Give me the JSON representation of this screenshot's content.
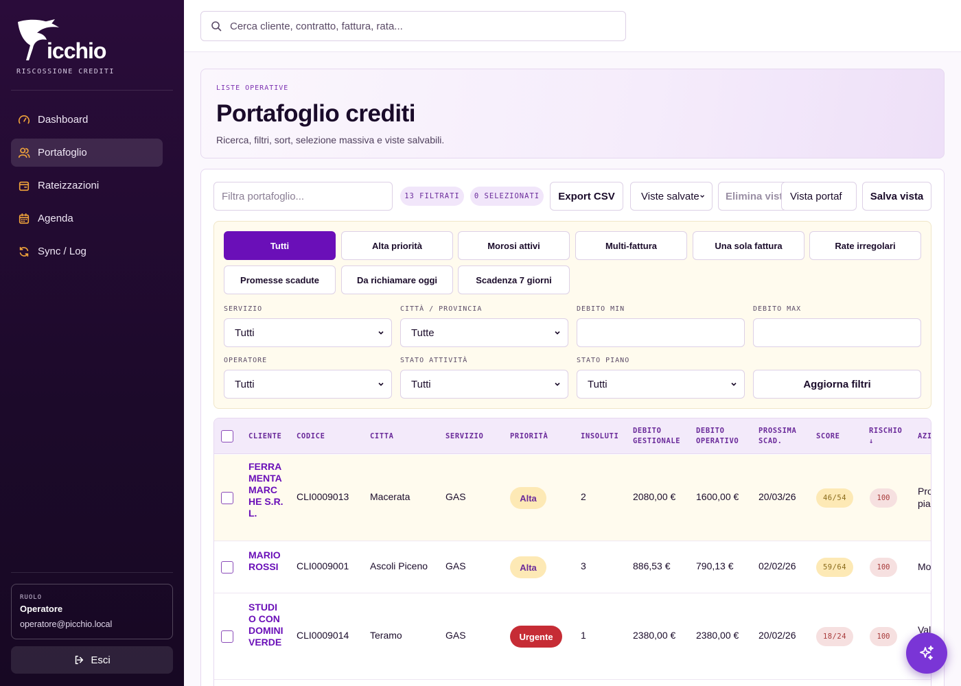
{
  "brand": {
    "name": "icchio",
    "subtitle": "RISCOSSIONE CREDITI"
  },
  "sidebar": {
    "items": [
      {
        "label": "Dashboard",
        "icon": "gauge-icon"
      },
      {
        "label": "Portafoglio",
        "icon": "users-icon",
        "active": true
      },
      {
        "label": "Rateizzazioni",
        "icon": "wallet-icon"
      },
      {
        "label": "Agenda",
        "icon": "calendar-icon"
      },
      {
        "label": "Sync / Log",
        "icon": "sync-icon"
      }
    ],
    "role_label": "RUOLO",
    "role_name": "Operatore",
    "role_email": "operatore@picchio.local",
    "logout_label": "Esci"
  },
  "search": {
    "placeholder": "Cerca cliente, contratto, fattura, rata..."
  },
  "hero": {
    "kicker": "LISTE OPERATIVE",
    "title": "Portafoglio crediti",
    "subtitle": "Ricerca, filtri, sort, selezione massiva e viste salvabili."
  },
  "toolbar": {
    "filter_placeholder": "Filtra portafoglio...",
    "filtered_pill": "13 FILTRATI",
    "selected_pill": "0 SELEZIONATI",
    "export_label": "Export CSV",
    "saved_views_label": "Viste salvate",
    "delete_view_label": "Elimina vista",
    "view_name_value": "Vista portaf",
    "save_view_label": "Salva vista"
  },
  "quick_filters": [
    "Tutti",
    "Alta priorità",
    "Morosi attivi",
    "Multi-fattura",
    "Una sola fattura",
    "Rate irregolari",
    "Promesse scadute",
    "Da richiamare oggi",
    "Scadenza 7 giorni"
  ],
  "filters": {
    "servizio": {
      "label": "SERVIZIO",
      "value": "Tutti"
    },
    "citta": {
      "label": "CITTÀ / PROVINCIA",
      "value": "Tutte"
    },
    "debito_min": {
      "label": "DEBITO MIN",
      "value": ""
    },
    "debito_max": {
      "label": "DEBITO MAX",
      "value": ""
    },
    "operatore": {
      "label": "OPERATORE",
      "value": "Tutti"
    },
    "stato_attivita": {
      "label": "STATO ATTIVITÀ",
      "value": "Tutti"
    },
    "stato_piano": {
      "label": "STATO PIANO",
      "value": "Tutti"
    },
    "update_label": "Aggiorna filtri"
  },
  "table": {
    "headers": {
      "cliente": "CLIENTE",
      "codice": "CODICE",
      "citta": "CITTA",
      "servizio": "SERVIZIO",
      "priorita": "PRIORITÀ",
      "insoluti": "INSOLUTI",
      "debito_gestionale": "DEBITO GESTIONALE",
      "debito_operativo": "DEBITO OPERATIVO",
      "prossima_scad": "PROSSIMA SCAD.",
      "score": "SCORE",
      "rischio": "RISCHIO ↓",
      "azioni": "AZI"
    },
    "rows": [
      {
        "cliente": "FERRAMENTA MARCHE S.R.L.",
        "codice": "CLI0009013",
        "citta": "Macerata",
        "servizio": "GAS",
        "priorita": "Alta",
        "insoluti": "2",
        "debito_gestionale": "2080,00 €",
        "debito_operativo": "1600,00 €",
        "prossima_scad": "20/03/26",
        "score": "46/54",
        "rischio": "100",
        "azione": "Pro pia"
      },
      {
        "cliente": "MARIO ROSSI",
        "codice": "CLI0009001",
        "citta": "Ascoli Piceno",
        "servizio": "GAS",
        "priorita": "Alta",
        "insoluti": "3",
        "debito_gestionale": "886,53 €",
        "debito_operativo": "790,13 €",
        "prossima_scad": "02/02/26",
        "score": "59/64",
        "rischio": "100",
        "azione": "Mo"
      },
      {
        "cliente": "STUDIO CONDOMINI VERDE",
        "codice": "CLI0009014",
        "citta": "Teramo",
        "servizio": "GAS",
        "priorita": "Urgente",
        "insoluti": "1",
        "debito_gestionale": "2380,00 €",
        "debito_operativo": "2380,00 €",
        "prossima_scad": "20/02/26",
        "score": "18/24",
        "rischio": "100",
        "azione": "Val"
      }
    ]
  },
  "colors": {
    "brand_purple": "#6a0fb8",
    "sidebar_bg": "#2a0c3a",
    "urgent_red": "#c62c35",
    "alta_yellow": "#fde9b5"
  }
}
